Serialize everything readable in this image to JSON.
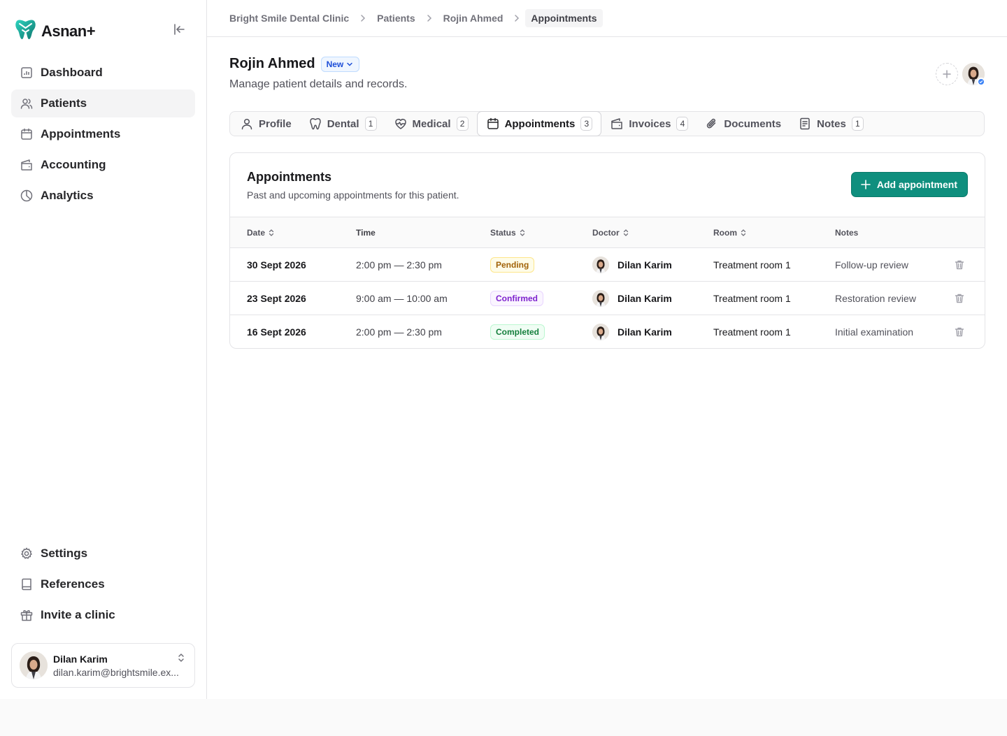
{
  "app": {
    "name": "Asnan+",
    "brand_color": "#0f8f7e"
  },
  "sidebar": {
    "nav_top": [
      {
        "label": "Dashboard",
        "icon": "dashboard-icon"
      },
      {
        "label": "Patients",
        "icon": "users-icon",
        "active": true
      },
      {
        "label": "Appointments",
        "icon": "calendar-icon"
      },
      {
        "label": "Accounting",
        "icon": "wallet-icon"
      },
      {
        "label": "Analytics",
        "icon": "pie-chart-icon"
      }
    ],
    "nav_bottom": [
      {
        "label": "Settings",
        "icon": "gear-icon"
      },
      {
        "label": "References",
        "icon": "book-icon"
      },
      {
        "label": "Invite a clinic",
        "icon": "gift-icon"
      }
    ],
    "user": {
      "name": "Dilan Karim",
      "email": "dilan.karim@brightsmile.ex..."
    }
  },
  "breadcrumb": [
    "Bright Smile Dental Clinic",
    "Patients",
    "Rojin Ahmed",
    "Appointments"
  ],
  "patient": {
    "name": "Rojin Ahmed",
    "badge": "New",
    "subtitle": "Manage patient details and records."
  },
  "tabs": [
    {
      "label": "Profile",
      "icon": "user-icon",
      "count": ""
    },
    {
      "label": "Dental",
      "icon": "tooth-icon",
      "count": "1"
    },
    {
      "label": "Medical",
      "icon": "heart-pulse-icon",
      "count": "2"
    },
    {
      "label": "Appointments",
      "icon": "calendar-icon",
      "count": "3",
      "active": true
    },
    {
      "label": "Invoices",
      "icon": "wallet-icon",
      "count": "4"
    },
    {
      "label": "Documents",
      "icon": "paperclip-icon",
      "count": ""
    },
    {
      "label": "Notes",
      "icon": "notes-icon",
      "count": "1"
    }
  ],
  "appointments": {
    "title": "Appointments",
    "subtitle": "Past and upcoming appointments for this patient.",
    "add_label": "Add appointment",
    "columns": {
      "date": "Date",
      "time": "Time",
      "status": "Status",
      "doctor": "Doctor",
      "room": "Room",
      "notes": "Notes"
    },
    "rows": [
      {
        "date": "30 Sept 2026",
        "time": "2:00 pm — 2:30 pm",
        "status": "Pending",
        "status_kind": "pending",
        "doctor": "Dilan Karim",
        "room": "Treatment room 1",
        "notes": "Follow-up review"
      },
      {
        "date": "23 Sept 2026",
        "time": "9:00 am — 10:00 am",
        "status": "Confirmed",
        "status_kind": "confirmed",
        "doctor": "Dilan Karim",
        "room": "Treatment room 1",
        "notes": "Restoration review"
      },
      {
        "date": "16 Sept 2026",
        "time": "2:00 pm — 2:30 pm",
        "status": "Completed",
        "status_kind": "completed",
        "doctor": "Dilan Karim",
        "room": "Treatment room 1",
        "notes": "Initial examination"
      }
    ]
  }
}
